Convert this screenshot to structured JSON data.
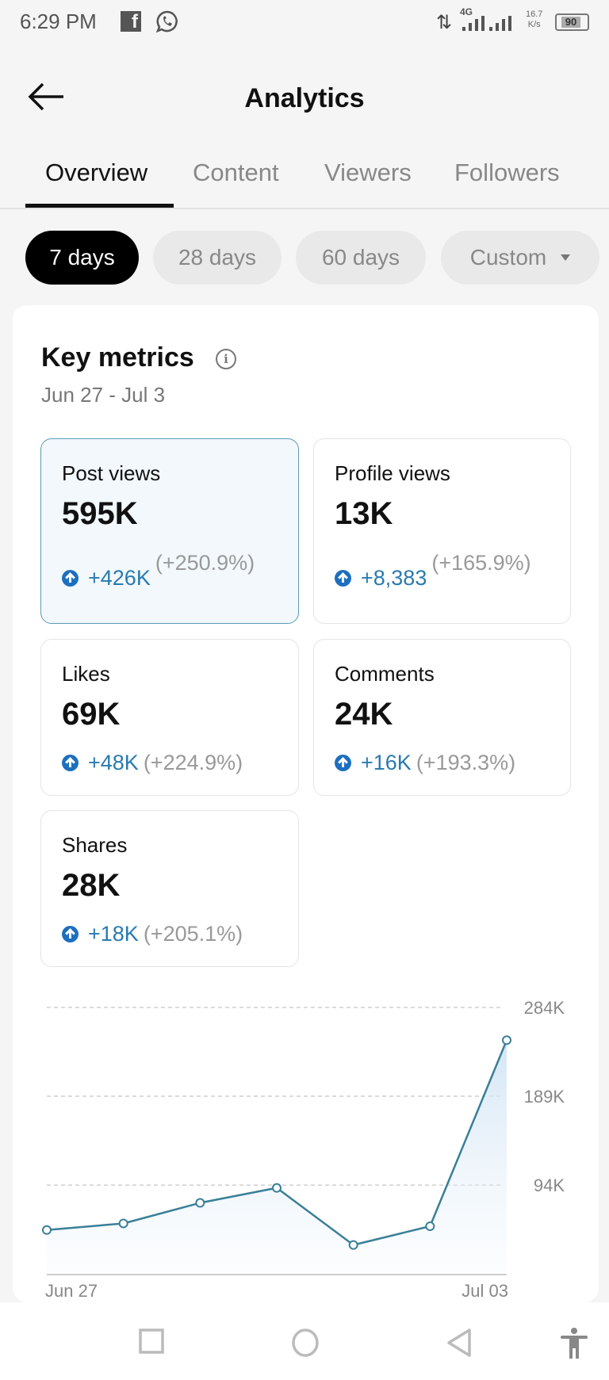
{
  "status_bar": {
    "time": "6:29 PM",
    "notification_icons": [
      "facebook-icon",
      "whatsapp-icon"
    ],
    "network_type": "4G",
    "speed_value": "16.7",
    "speed_unit": "K/s",
    "battery": "90"
  },
  "header": {
    "back_icon": "arrow-left-icon",
    "title": "Analytics"
  },
  "tabs": [
    {
      "label": "Overview",
      "active": true
    },
    {
      "label": "Content",
      "active": false
    },
    {
      "label": "Viewers",
      "active": false
    },
    {
      "label": "Followers",
      "active": false
    }
  ],
  "date_filters": [
    {
      "label": "7 days",
      "active": true
    },
    {
      "label": "28 days",
      "active": false
    },
    {
      "label": "60 days",
      "active": false
    },
    {
      "label": "Custom",
      "active": false,
      "has_dropdown": true
    }
  ],
  "key_metrics": {
    "title": "Key metrics",
    "info_icon": "info-icon",
    "date_range": "Jun 27 - Jul 3",
    "metrics": [
      {
        "label": "Post views",
        "value": "595K",
        "delta": "+426K",
        "delta_pct": "(+250.9%)",
        "selected": true
      },
      {
        "label": "Profile views",
        "value": "13K",
        "delta": "+8,383",
        "delta_pct": "(+165.9%)",
        "selected": false
      },
      {
        "label": "Likes",
        "value": "69K",
        "delta": "+48K",
        "delta_pct": "(+224.9%)",
        "selected": false
      },
      {
        "label": "Comments",
        "value": "24K",
        "delta": "+16K",
        "delta_pct": "(+193.3%)",
        "selected": false
      },
      {
        "label": "Shares",
        "value": "28K",
        "delta": "+18K",
        "delta_pct": "(+205.1%)",
        "selected": false
      }
    ]
  },
  "colors": {
    "accent_line": "#3a7f98",
    "up_badge": "#1d6fc0",
    "delta_text": "#2a7ab0",
    "selected_card_border": "#5b9bb5"
  },
  "chart_data": {
    "type": "area",
    "title": "Post views",
    "x": [
      "Jun 27",
      "Jun 28",
      "Jun 29",
      "Jun 30",
      "Jul 01",
      "Jul 02",
      "Jul 03"
    ],
    "series": [
      {
        "name": "Post views",
        "values": [
          46000,
          53000,
          75000,
          91000,
          30000,
          50000,
          249000
        ]
      }
    ],
    "x_tick_labels": [
      "Jun 27",
      "Jul 03"
    ],
    "y_ticks": [
      94000,
      189000,
      284000
    ],
    "y_tick_labels": [
      "94K",
      "189K",
      "284K"
    ],
    "ylim": [
      0,
      284000
    ],
    "y_axis_position": "right",
    "grid": "dashed-horizontal",
    "legend": "none"
  },
  "nav_bar": {
    "buttons": [
      "recents-icon",
      "home-icon",
      "back-icon",
      "accessibility-icon"
    ]
  }
}
